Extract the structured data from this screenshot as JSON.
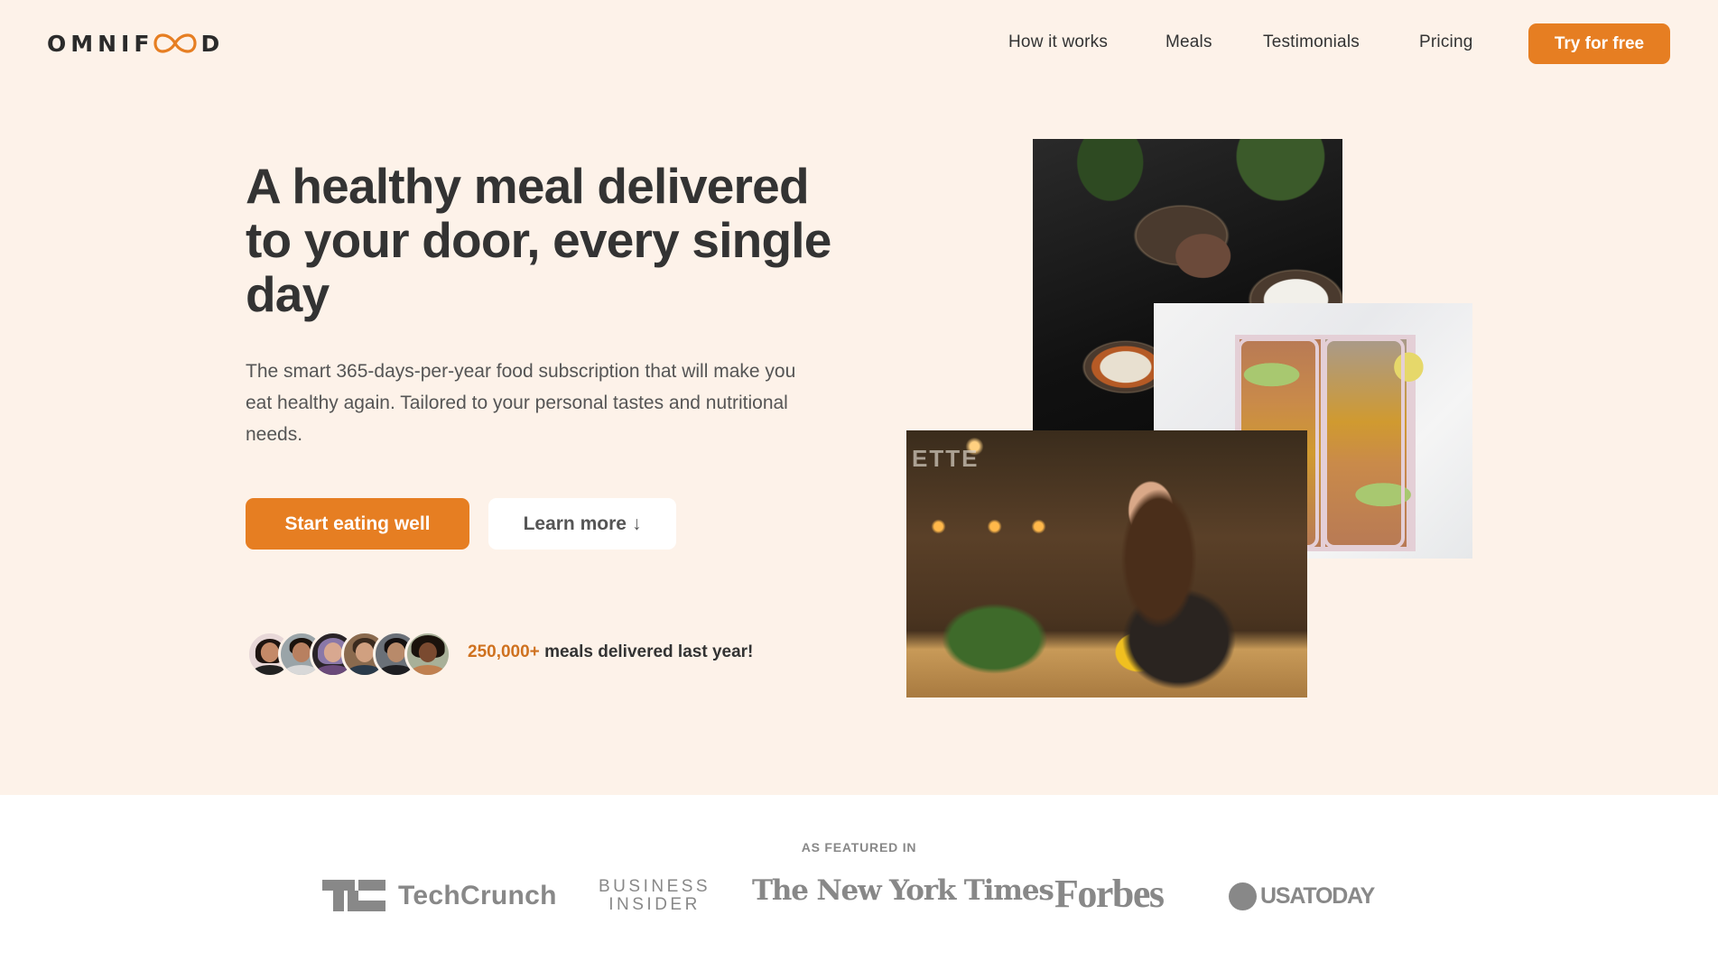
{
  "brand": {
    "name_prefix": "OMNIF",
    "name_suffix": "D",
    "accent_color": "#e67e22",
    "logo_icon": "infinity-icon"
  },
  "nav": {
    "links": [
      {
        "label": "How it works"
      },
      {
        "label": "Meals"
      },
      {
        "label": "Testimonials"
      },
      {
        "label": "Pricing"
      }
    ],
    "cta_label": "Try for free"
  },
  "hero": {
    "title": "A healthy meal delivered to your door, every single day",
    "description": "The smart 365-days-per-year food subscription that will make you eat healthy again. Tailored to your personal tastes and nutritional needs.",
    "primary_button": "Start eating well",
    "secondary_button": "Learn more",
    "secondary_icon": "↓",
    "delivered": {
      "count": "250,000+",
      "text": "meals delivered last year!",
      "customer_avatar_count": 6
    },
    "images": [
      {
        "alt": "Bowls of healthy food with rice, vegetables and meat"
      },
      {
        "alt": "Lunch boxes with chickpeas, avocado and curry"
      },
      {
        "alt": "Woman enjoying a meal in a restaurant"
      }
    ],
    "image_sign_text": "ETTE"
  },
  "featured": {
    "label": "AS FEATURED IN",
    "logos": [
      {
        "name": "TechCrunch",
        "text": "TechCrunch"
      },
      {
        "name": "Business Insider",
        "line1": "BUSINESS",
        "line2": "INSIDER"
      },
      {
        "name": "The New York Times",
        "text": "The New York Times"
      },
      {
        "name": "Forbes",
        "text": "Forbes"
      },
      {
        "name": "USA Today",
        "text": "USATODAY"
      }
    ]
  },
  "colors": {
    "hero_background": "#fdf2e9",
    "primary": "#e67e22",
    "text_dark": "#333333",
    "logo_gray": "#888888"
  }
}
